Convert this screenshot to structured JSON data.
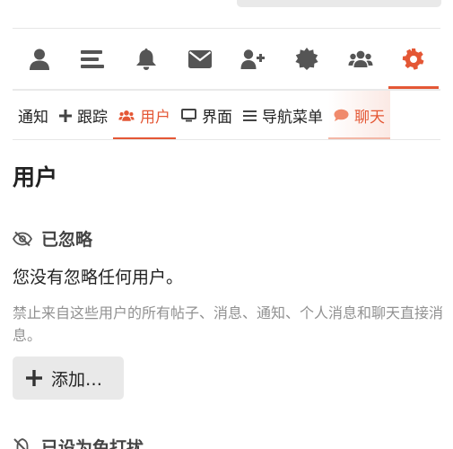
{
  "icon_nav": {
    "tabs": [
      {
        "icon": "user-icon",
        "active": false
      },
      {
        "icon": "list-icon",
        "active": false
      },
      {
        "icon": "bell-icon",
        "active": false
      },
      {
        "icon": "envelope-icon",
        "active": false
      },
      {
        "icon": "user-plus-icon",
        "active": false
      },
      {
        "icon": "badge-icon",
        "active": false
      },
      {
        "icon": "users-icon",
        "active": false
      },
      {
        "icon": "gear-icon",
        "active": true
      }
    ],
    "accent_color": "#e45735",
    "inactive_color": "#555555"
  },
  "text_nav": {
    "notifications": "通知",
    "tracking": "跟踪",
    "users": "用户",
    "interface": "界面",
    "nav_menu": "导航菜单",
    "chat": "聊天"
  },
  "page": {
    "title": "用户"
  },
  "ignored": {
    "heading": "已忽略",
    "empty_message": "您没有忽略任何用户。",
    "description": "禁止来自这些用户的所有帖子、消息、通知、个人消息和聊天直接消息。",
    "add_button": "添加…"
  },
  "next_section": {
    "heading": "已设为免打扰"
  }
}
